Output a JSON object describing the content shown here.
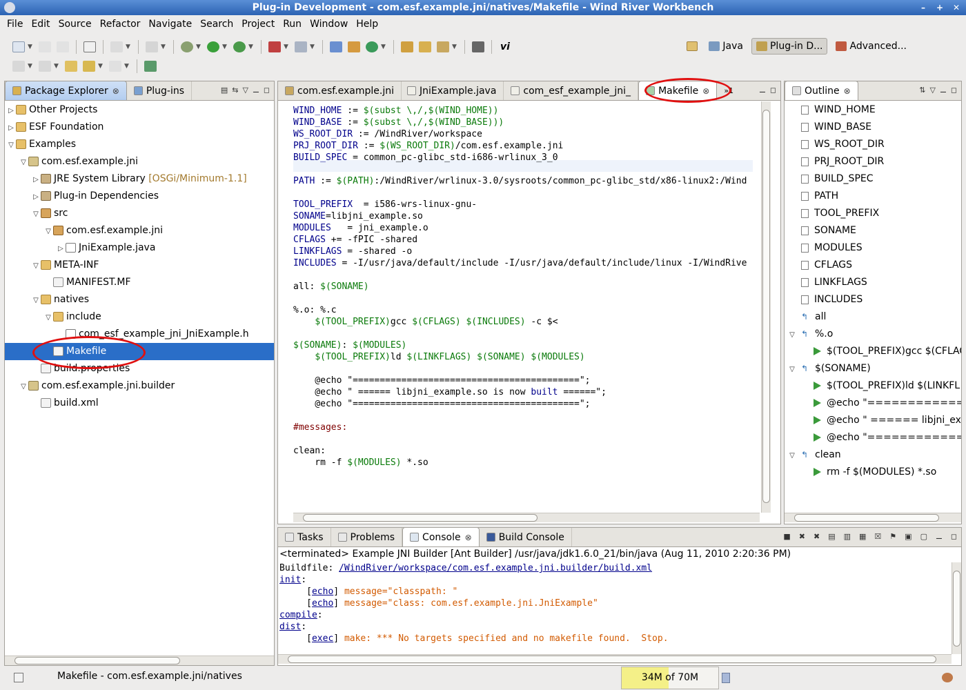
{
  "window": {
    "title": "Plug-in Development - com.esf.example.jni/natives/Makefile - Wind River Workbench"
  },
  "menu": [
    "File",
    "Edit",
    "Source",
    "Refactor",
    "Navigate",
    "Search",
    "Project",
    "Run",
    "Window",
    "Help"
  ],
  "perspectives": [
    {
      "label": "Java",
      "icon": "java-perspective-icon",
      "active": false
    },
    {
      "label": "Plug-in D...",
      "icon": "plugin-perspective-icon",
      "active": true
    },
    {
      "label": "Advanced...",
      "icon": "advanced-perspective-icon",
      "active": false
    }
  ],
  "package_explorer": {
    "tabs": [
      {
        "label": "Package Explorer"
      },
      {
        "label": "Plug-ins"
      }
    ],
    "tree": [
      {
        "label": "Other Projects",
        "icon": "folder-icon"
      },
      {
        "label": "ESF Foundation",
        "icon": "folder-icon"
      },
      {
        "label": "Examples",
        "icon": "folder-icon"
      },
      {
        "label": "com.esf.example.jni",
        "icon": "project-icon"
      },
      {
        "label": "JRE System Library",
        "decor": "[OSGi/Minimum-1.1]",
        "icon": "library-icon"
      },
      {
        "label": "Plug-in Dependencies",
        "icon": "library-icon"
      },
      {
        "label": "src",
        "icon": "source-folder-icon"
      },
      {
        "label": "com.esf.example.jni",
        "icon": "package-icon"
      },
      {
        "label": "JniExample.java",
        "icon": "java-file-icon"
      },
      {
        "label": "META-INF",
        "icon": "folder-icon"
      },
      {
        "label": "MANIFEST.MF",
        "icon": "manifest-icon"
      },
      {
        "label": "natives",
        "icon": "folder-icon"
      },
      {
        "label": "include",
        "icon": "folder-icon"
      },
      {
        "label": "com_esf_example_jni_JniExample.h",
        "icon": "header-file-icon"
      },
      {
        "label": "Makefile",
        "icon": "makefile-icon"
      },
      {
        "label": "build.properties",
        "icon": "properties-file-icon"
      },
      {
        "label": "com.esf.example.jni.builder",
        "icon": "project-icon"
      },
      {
        "label": "build.xml",
        "icon": "xml-file-icon"
      }
    ]
  },
  "editor": {
    "tabs": [
      {
        "label": "com.esf.example.jni"
      },
      {
        "label": "JniExample.java"
      },
      {
        "label": "com_esf_example_jni_"
      },
      {
        "label": "Makefile"
      }
    ],
    "overflow": "1"
  },
  "outline": {
    "title": "Outline",
    "items": [
      {
        "label": "WIND_HOME"
      },
      {
        "label": "WIND_BASE"
      },
      {
        "label": "WS_ROOT_DIR"
      },
      {
        "label": "PRJ_ROOT_DIR"
      },
      {
        "label": "BUILD_SPEC"
      },
      {
        "label": "PATH"
      },
      {
        "label": "TOOL_PREFIX"
      },
      {
        "label": "SONAME"
      },
      {
        "label": "MODULES"
      },
      {
        "label": "CFLAGS"
      },
      {
        "label": "LINKFLAGS"
      },
      {
        "label": "INCLUDES"
      },
      {
        "label": "all"
      },
      {
        "label": "%.o"
      },
      {
        "label": "$(TOOL_PREFIX)gcc $(CFLAG"
      },
      {
        "label": "$(SONAME)"
      },
      {
        "label": "$(TOOL_PREFIX)ld $(LINKFL ..."
      },
      {
        "label": "@echo \"=================="
      },
      {
        "label": "@echo \" ====== libjni_exa ..."
      },
      {
        "label": "@echo \"=================="
      },
      {
        "label": "clean"
      },
      {
        "label": "rm -f $(MODULES) *.so"
      }
    ]
  },
  "console": {
    "tabs": [
      {
        "label": "Tasks"
      },
      {
        "label": "Problems"
      },
      {
        "label": "Console"
      },
      {
        "label": "Build Console"
      }
    ],
    "header": "<terminated> Example JNI Builder [Ant Builder] /usr/java/jdk1.6.0_21/bin/java (Aug 11, 2010 2:20:36 PM)"
  },
  "status": {
    "text": "Makefile - com.esf.example.jni/natives",
    "memory": "34M of 70M",
    "memory_used_fraction": 0.486
  }
}
